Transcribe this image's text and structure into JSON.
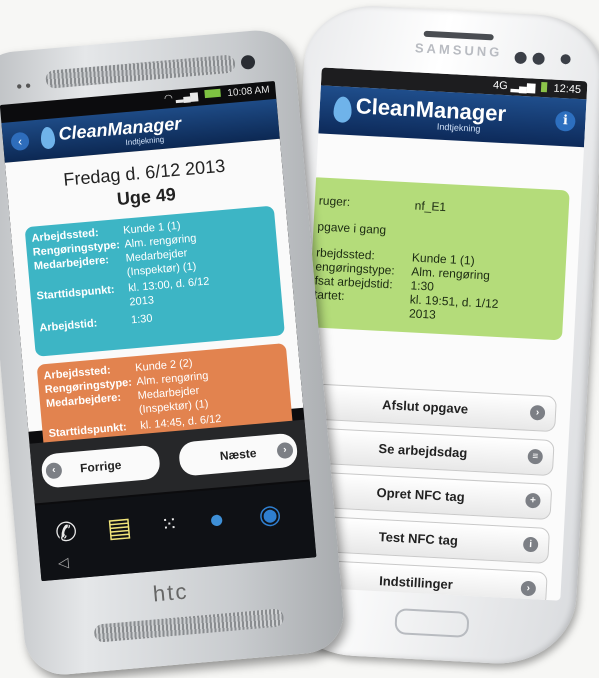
{
  "samsung": {
    "brand": "SAMSUNG",
    "status_right": "12:45",
    "status_net": "4G",
    "app_title": "CleanManager",
    "app_subtitle": "Indtjekning",
    "info_icon": "i",
    "card": {
      "bruger_label": "ruger:",
      "bruger_value": "nf_E1",
      "status_text": "pgave i gang",
      "arbejdssted_label": "rbejdssted:",
      "arbejdssted_value": "Kunde 1 (1)",
      "rengoring_label": "engøringstype:",
      "rengoring_value": "Alm. rengøring",
      "afsat_label": "fsat arbejdstid:",
      "afsat_value": "1:30",
      "startet_label": "tartet:",
      "startet_value_1": "kl. 19:51, d. 1/12",
      "startet_value_2": "2013"
    },
    "buttons": [
      "Afslut opgave",
      "Se arbejdsdag",
      "Opret NFC tag",
      "Test NFC tag",
      "Indstillinger"
    ],
    "button_icons": [
      "arrow-right-icon",
      "menu-icon",
      "plus-icon",
      "info-icon",
      "arrow-icon"
    ]
  },
  "htc": {
    "status_time": "10:08 AM",
    "app_title": "CleanManager",
    "app_subtitle": "Indtjekning",
    "date_line": "Fredag d. 6/12 2013",
    "week_line": "Uge 49",
    "card1": {
      "arbejdssted_label": "Arbejdssted:",
      "arbejdssted_value": "Kunde 1 (1)",
      "rengoring_label": "Rengøringstype:",
      "rengoring_value": "Alm. rengøring",
      "medarbejdere_label": "Medarbejdere:",
      "medarbejdere_value_1": "Medarbejder",
      "medarbejdere_value_2": "(Inspektør) (1)",
      "start_label": "Starttidspunkt:",
      "start_value_1": "kl. 13:00, d. 6/12",
      "start_value_2": "2013",
      "arbejdstid_label": "Arbejdstid:",
      "arbejdstid_value": "1:30"
    },
    "card2": {
      "arbejdssted_label": "Arbejdssted:",
      "arbejdssted_value": "Kunde 2 (2)",
      "rengoring_label": "Rengøringstype:",
      "rengoring_value": "Alm. rengøring",
      "medarbejdere_label": "Medarbejdere:",
      "medarbejdere_value_1": "Medarbejder",
      "medarbejdere_value_2": "(Inspektør) (1)",
      "start_label": "Starttidspunkt:",
      "start_value_1": "kl. 14:45, d. 6/12"
    },
    "prev_label": "Forrige",
    "next_label": "Næste",
    "brand_logo": "htc"
  },
  "colors": {
    "header_blue": "#1e4b86",
    "card_green": "#b4dc7a",
    "card_teal": "#3db5c5",
    "card_orange": "#e2834f"
  }
}
